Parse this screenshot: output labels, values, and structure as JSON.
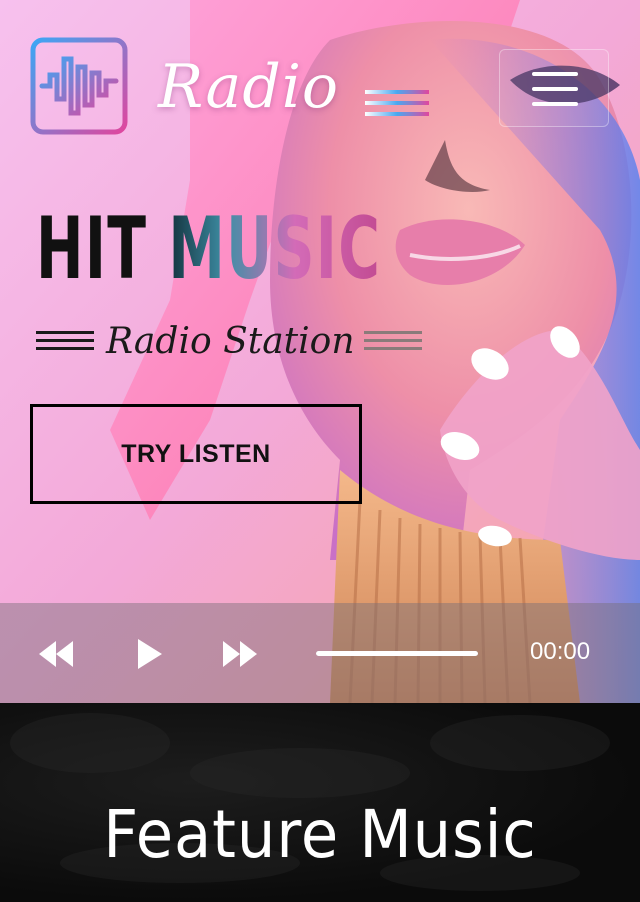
{
  "header": {
    "brand": "Radio",
    "logo_icon": "sound-wave-icon",
    "menu_icon": "hamburger-menu-icon"
  },
  "hero": {
    "headline": "HIT MUSIC",
    "subtitle": "Radio Station",
    "cta_label": "TRY LISTEN"
  },
  "player": {
    "controls": [
      {
        "icon": "rewind-icon"
      },
      {
        "icon": "play-icon"
      },
      {
        "icon": "fast-forward-icon"
      }
    ],
    "time": "00:00",
    "progress": 1.0
  },
  "feature": {
    "title": "Feature Music"
  },
  "colors": {
    "hero_background": "#f4b2e6",
    "accent_pink": "#e0469e",
    "accent_blue": "#4aa8f0",
    "feature_background": "#0b0b0b"
  }
}
